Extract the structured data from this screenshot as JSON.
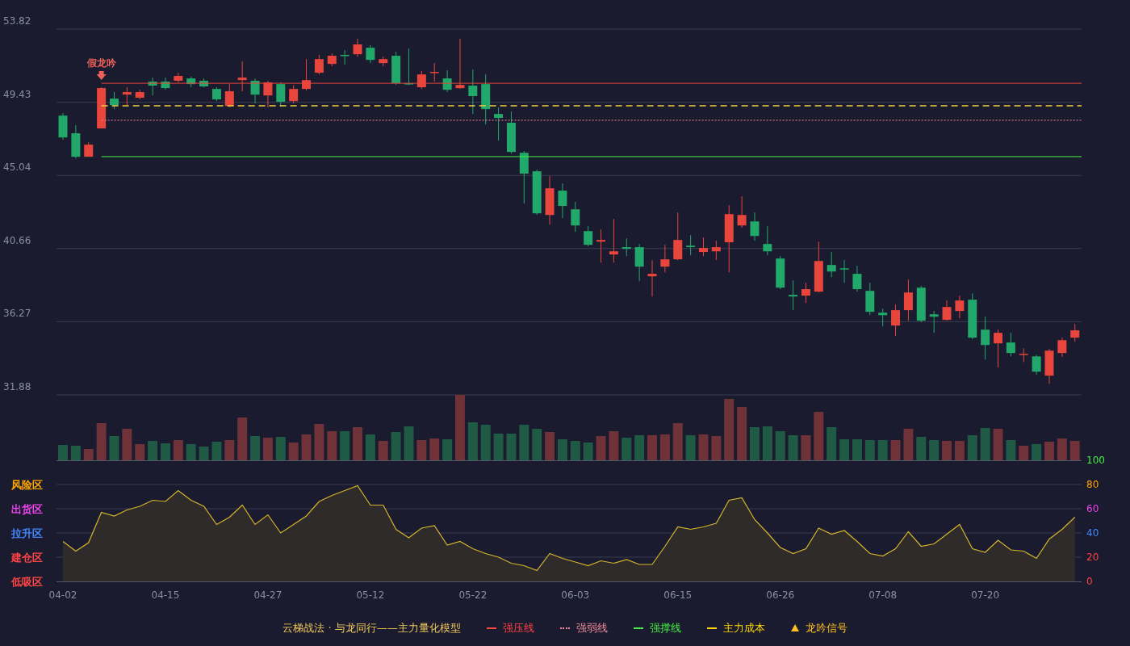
{
  "price_chart": {
    "chart_data": {
      "type": "candlestick",
      "grid": true,
      "ylim": [
        31.88,
        53.82
      ],
      "yticks": [
        53.82,
        49.43,
        45.04,
        40.66,
        36.27,
        31.88
      ],
      "ohlc": [
        [
          48.63,
          48.78,
          47.18,
          47.32
        ],
        [
          47.57,
          48.05,
          46.06,
          46.16
        ],
        [
          46.16,
          47.03,
          46.16,
          46.89
        ],
        [
          47.86,
          50.33,
          47.86,
          50.28
        ],
        [
          49.65,
          50.04,
          49.02,
          49.26
        ],
        [
          49.89,
          50.33,
          49.26,
          50.04
        ],
        [
          49.7,
          50.18,
          49.6,
          50.04
        ],
        [
          50.67,
          50.91,
          49.84,
          50.43
        ],
        [
          50.67,
          50.91,
          50.18,
          50.28
        ],
        [
          50.72,
          51.2,
          50.62,
          51.01
        ],
        [
          50.86,
          50.96,
          50.33,
          50.52
        ],
        [
          50.72,
          50.86,
          50.33,
          50.38
        ],
        [
          50.23,
          50.33,
          49.5,
          49.6
        ],
        [
          49.21,
          50.52,
          49.12,
          50.09
        ],
        [
          50.76,
          51.88,
          50.09,
          50.91
        ],
        [
          50.72,
          50.86,
          49.36,
          49.89
        ],
        [
          49.84,
          50.72,
          49.12,
          50.62
        ],
        [
          50.52,
          50.62,
          49.17,
          49.46
        ],
        [
          49.5,
          50.47,
          49.36,
          50.23
        ],
        [
          50.23,
          52.02,
          50.14,
          50.76
        ],
        [
          51.2,
          52.27,
          51.1,
          52.02
        ],
        [
          51.73,
          52.36,
          51.59,
          52.22
        ],
        [
          52.27,
          52.56,
          51.68,
          52.22
        ],
        [
          52.31,
          53.24,
          52.17,
          52.9
        ],
        [
          52.7,
          52.85,
          51.78,
          51.97
        ],
        [
          51.78,
          52.17,
          51.59,
          52.02
        ],
        [
          52.22,
          52.46,
          50.47,
          50.57
        ],
        [
          50.57,
          52.65,
          50.47,
          50.52
        ],
        [
          50.33,
          51.3,
          50.23,
          51.1
        ],
        [
          51.2,
          51.78,
          50.67,
          51.25
        ],
        [
          50.86,
          51.35,
          50.04,
          50.18
        ],
        [
          50.28,
          53.24,
          50.23,
          50.47
        ],
        [
          50.43,
          51.39,
          48.73,
          49.8
        ],
        [
          50.52,
          51.1,
          48.1,
          49.02
        ],
        [
          48.73,
          49.12,
          47.13,
          48.49
        ],
        [
          48.2,
          48.87,
          46.35,
          46.45
        ],
        [
          46.4,
          46.5,
          43.35,
          45.15
        ],
        [
          45.29,
          45.39,
          42.67,
          42.77
        ],
        [
          42.67,
          45.0,
          42.09,
          44.27
        ],
        [
          44.13,
          44.56,
          42.48,
          43.21
        ],
        [
          43.01,
          43.45,
          41.66,
          42.04
        ],
        [
          41.7,
          41.99,
          40.79,
          40.88
        ],
        [
          41.07,
          41.8,
          39.81,
          41.17
        ],
        [
          40.3,
          42.43,
          39.81,
          40.49
        ],
        [
          40.74,
          41.27,
          40.2,
          40.64
        ],
        [
          40.74,
          40.93,
          38.7,
          39.57
        ],
        [
          38.99,
          39.96,
          37.78,
          39.14
        ],
        [
          39.57,
          40.88,
          39.23,
          40.01
        ],
        [
          40.01,
          42.82,
          39.96,
          41.17
        ],
        [
          40.83,
          41.46,
          40.25,
          40.74
        ],
        [
          40.45,
          41.32,
          40.2,
          40.69
        ],
        [
          40.49,
          41.12,
          39.96,
          40.74
        ],
        [
          41.03,
          43.25,
          39.23,
          42.72
        ],
        [
          42.04,
          43.79,
          41.9,
          42.67
        ],
        [
          42.28,
          42.82,
          41.12,
          41.41
        ],
        [
          40.93,
          41.99,
          40.25,
          40.49
        ],
        [
          40.06,
          40.2,
          38.22,
          38.31
        ],
        [
          37.88,
          38.75,
          36.96,
          37.78
        ],
        [
          37.83,
          38.6,
          37.39,
          38.22
        ],
        [
          38.07,
          41.07,
          38.02,
          39.91
        ],
        [
          39.67,
          40.45,
          38.94,
          39.28
        ],
        [
          39.47,
          39.96,
          38.6,
          39.43
        ],
        [
          39.14,
          39.62,
          38.07,
          38.22
        ],
        [
          38.12,
          38.6,
          36.66,
          36.86
        ],
        [
          36.81,
          37.05,
          35.99,
          36.66
        ],
        [
          36.04,
          37.3,
          35.41,
          36.96
        ],
        [
          36.96,
          38.8,
          36.33,
          38.02
        ],
        [
          38.31,
          38.41,
          36.23,
          36.33
        ],
        [
          36.71,
          36.91,
          35.6,
          36.57
        ],
        [
          36.38,
          37.54,
          36.33,
          37.15
        ],
        [
          36.91,
          37.83,
          36.47,
          37.54
        ],
        [
          37.59,
          37.97,
          35.21,
          35.31
        ],
        [
          35.79,
          36.57,
          34.0,
          34.87
        ],
        [
          34.97,
          35.79,
          33.52,
          35.6
        ],
        [
          35.02,
          35.6,
          34.19,
          34.39
        ],
        [
          34.29,
          34.68,
          33.85,
          34.34
        ],
        [
          34.19,
          34.29,
          33.08,
          33.27
        ],
        [
          33.03,
          34.63,
          32.55,
          34.53
        ],
        [
          34.39,
          35.31,
          34.15,
          35.16
        ],
        [
          35.31,
          36.14,
          35.07,
          35.75
        ]
      ],
      "ref_lines": [
        {
          "axis": "y",
          "value": 50.57,
          "color": "#e8453c"
        },
        {
          "axis": "y",
          "value": 48.35,
          "color": "#f08a9a"
        },
        {
          "axis": "y",
          "value": 46.17,
          "color": "#44ee44"
        },
        {
          "axis": "y",
          "value": 49.22,
          "color": "#f0d040"
        }
      ],
      "annotations": [
        {
          "text": "假龙吟"
        }
      ]
    }
  },
  "oscillator": {
    "chart_data": {
      "type": "area",
      "grid": true,
      "ylim": [
        0,
        100
      ],
      "yticks": [
        0,
        20,
        40,
        60,
        80,
        100
      ],
      "categories": [
        "04-02",
        null,
        null,
        null,
        null,
        null,
        null,
        null,
        "04-15",
        null,
        null,
        null,
        null,
        null,
        null,
        null,
        "04-27",
        null,
        null,
        null,
        null,
        null,
        null,
        null,
        "05-12",
        null,
        null,
        null,
        null,
        null,
        null,
        null,
        "05-22",
        null,
        null,
        null,
        null,
        null,
        null,
        null,
        "06-03",
        null,
        null,
        null,
        null,
        null,
        null,
        null,
        "06-15",
        null,
        null,
        null,
        null,
        null,
        null,
        null,
        "06-26",
        null,
        null,
        null,
        null,
        null,
        null,
        null,
        "07-08",
        null,
        null,
        null,
        null,
        null,
        null,
        null,
        "07-20",
        null,
        null,
        null,
        null,
        null,
        null,
        null
      ],
      "series": [
        {
          "color": "#d4b52a",
          "values": [
            33,
            25,
            32,
            57,
            54,
            59,
            62,
            67,
            66,
            75,
            67,
            62,
            47,
            53,
            63,
            47,
            55,
            40,
            47,
            54,
            66,
            71,
            75,
            79,
            63,
            63,
            43,
            36,
            44,
            46,
            30,
            33,
            27,
            23,
            20,
            15,
            13,
            9,
            23,
            19,
            16,
            13,
            17,
            15,
            18,
            14,
            14,
            29,
            45,
            43,
            45,
            48,
            67,
            69,
            51,
            40,
            28,
            23,
            27,
            44,
            39,
            42,
            33,
            23,
            21,
            27,
            41,
            29,
            31,
            39,
            47,
            27,
            24,
            34,
            26,
            25,
            19,
            35,
            43,
            53
          ]
        }
      ]
    },
    "top_tick": {
      "color": "#44ee44"
    },
    "zones": [
      {
        "label": "风险区",
        "color": "#ffa500"
      },
      {
        "label": "出货区",
        "color": "#ee44ee"
      },
      {
        "label": "拉升区",
        "color": "#4488ff"
      },
      {
        "label": "建仓区",
        "color": "#ff4444"
      },
      {
        "label": "低吸区",
        "color": "#ff4444"
      }
    ]
  },
  "legend": {
    "title": "云梯战法 · 与龙同行——主力量化模型",
    "items": [
      {
        "kind": "solid",
        "label": "强压线",
        "color": "#ff4444"
      },
      {
        "kind": "dotted",
        "label": "强弱线",
        "color": "#f08a9a"
      },
      {
        "kind": "solid",
        "label": "强撑线",
        "color": "#44ee44"
      },
      {
        "kind": "dashed",
        "label": "主力成本",
        "color": "#ffd700"
      },
      {
        "kind": "triangle",
        "label": "龙吟信号",
        "color": "#ffc020"
      }
    ]
  }
}
